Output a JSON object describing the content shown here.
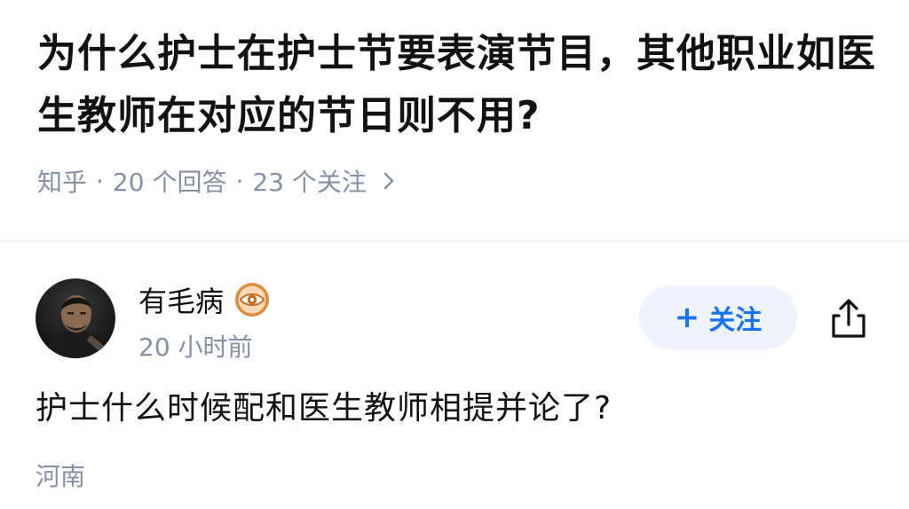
{
  "question": {
    "title": "为什么护士在护士节要表演节目，其他职业如医生教师在对应的节日则不用?",
    "source": "知乎",
    "separator": "·",
    "answer_count": "20 个回答",
    "follower_count": "23 个关注"
  },
  "answer": {
    "author_name": "有毛病",
    "time": "20 小时前",
    "follow_plus": "+",
    "follow_label": "关注",
    "content": "护士什么时候配和医生教师相提并论了?",
    "location": "河南"
  },
  "icons": {
    "meta_arrow": "chevron-right-icon",
    "badge": "eye-badge-icon",
    "share": "share-icon"
  },
  "colors": {
    "accent": "#1772f6",
    "follow_bg": "#eef3fc",
    "meta_gray": "#8590a6",
    "badge_orange": "#e08a3c"
  }
}
